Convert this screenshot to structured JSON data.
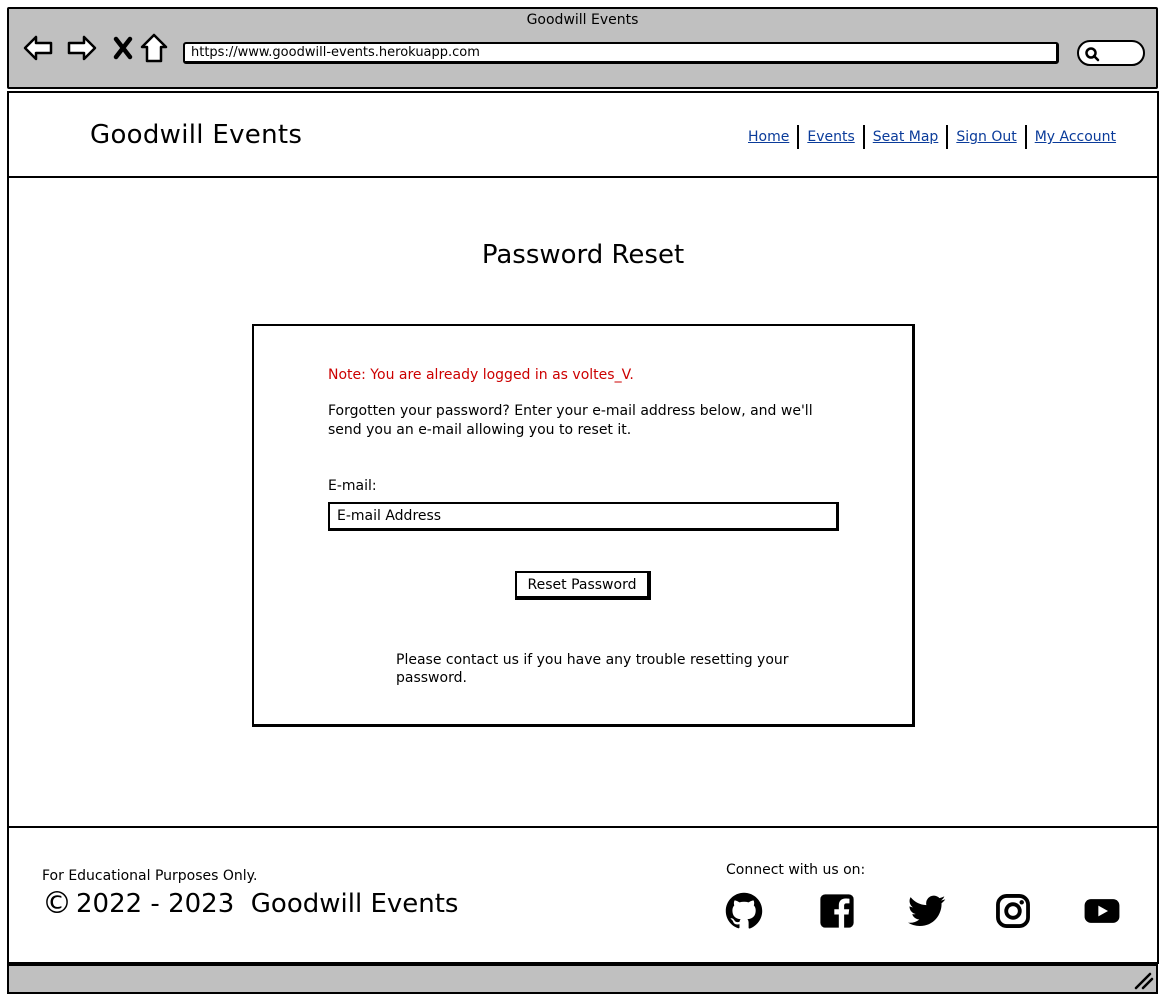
{
  "browser": {
    "window_title": "Goodwill Events",
    "url": "https://www.goodwill-events.herokuapp.com",
    "icons": [
      "back-arrow-icon",
      "forward-arrow-icon",
      "close-icon",
      "home-icon",
      "search-icon",
      "resize-grip-icon"
    ]
  },
  "header": {
    "brand": "Goodwill Events",
    "nav": [
      {
        "label": "Home"
      },
      {
        "label": "Events"
      },
      {
        "label": "Seat Map"
      },
      {
        "label": "Sign Out"
      },
      {
        "label": "My Account"
      }
    ],
    "link_color": "#0a3b9a"
  },
  "main": {
    "title": "Password Reset",
    "note": "Note: You are already logged in as voltes_V.",
    "note_color": "#cc0000",
    "intro": "Forgotten your password? Enter your e-mail address below, and we'll send you an e-mail allowing you to reset it.",
    "email_label": "E-mail:",
    "email_placeholder": "E-mail Address",
    "email_value": "",
    "reset_button": "Reset Password",
    "contact": "Please contact us if you have any trouble resetting your password."
  },
  "footer": {
    "edu_note": "For Educational Purposes Only.",
    "copyright_symbol": "©",
    "copyright": "2022 - 2023  Goodwill Events",
    "connect_label": "Connect with us on:",
    "social_icons": [
      "github-icon",
      "facebook-icon",
      "twitter-icon",
      "instagram-icon",
      "youtube-icon"
    ]
  }
}
